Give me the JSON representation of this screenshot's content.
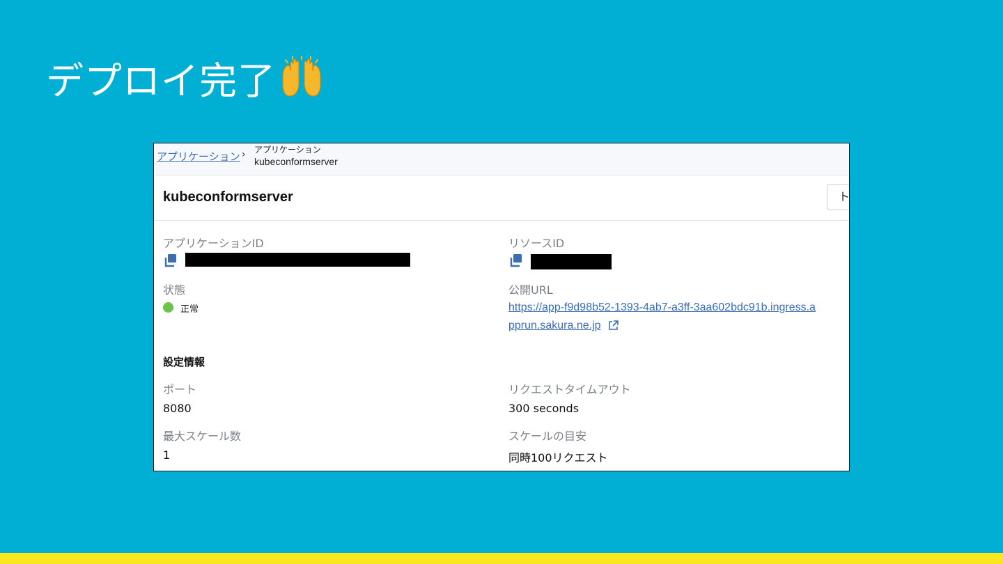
{
  "slide": {
    "title": "デプロイ完了",
    "emoji_icon": "raising-hands-emoji",
    "background_color": "#00afd3",
    "bar_color": "#f7e71c"
  },
  "breadcrumb": {
    "parent_link": "アプリケーション",
    "separator": "›",
    "current_category": "アプリケーション",
    "current_name": "kubeconformserver"
  },
  "header": {
    "app_name": "kubeconformserver",
    "button_label": "ト"
  },
  "details": {
    "application_id_label": "アプリケーションID",
    "resource_id_label": "リソースID",
    "status_label": "状態",
    "status_value": "正常",
    "status_color": "#6cc24a",
    "public_url_label": "公開URL",
    "public_url_line1": "https://app-f9d98b52-1393-4ab7-a3ff-3aa602bdc91b.ingress.a",
    "public_url_line2": "pprun.sakura.ne.jp",
    "link_color": "#3b6db3"
  },
  "settings": {
    "section_title": "設定情報",
    "port_label": "ポート",
    "port_value": "8080",
    "timeout_label": "リクエストタイムアウト",
    "timeout_value": "300 seconds",
    "max_scale_label": "最大スケール数",
    "max_scale_value": "1",
    "scale_target_label": "スケールの目安",
    "scale_target_value": "同時100リクエスト"
  }
}
